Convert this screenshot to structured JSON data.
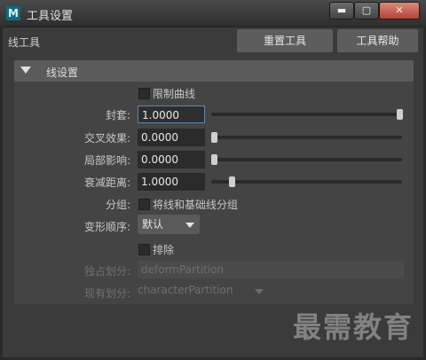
{
  "window": {
    "app_icon_letter": "M",
    "title": "工具设置",
    "minimize_glyph": "▬",
    "maximize_glyph": "▢",
    "close_glyph": "✕"
  },
  "toolbar": {
    "tool_name": "线工具",
    "reset_label": "重置工具",
    "help_label": "工具帮助"
  },
  "section": {
    "title": "线设置",
    "expanded": true
  },
  "settings": {
    "limit_curve_label": "限制曲线",
    "limit_curve_checked": false,
    "envelope": {
      "label": "封套:",
      "value": "1.0000",
      "slider_fraction": 1.0
    },
    "cross_effect": {
      "label": "交叉效果:",
      "value": "0.0000",
      "slider_fraction": 0.0
    },
    "local_influence": {
      "label": "局部影响:",
      "value": "0.0000",
      "slider_fraction": 0.0
    },
    "falloff_distance": {
      "label": "衰减距离:",
      "value": "1.0000",
      "slider_fraction": 0.1
    },
    "group_label": "分组:",
    "group_option_label": "将线和基础线分组",
    "group_checked": false,
    "deform_order_label": "变形顺序:",
    "deform_order_value": "默认",
    "exclude_label": "排除",
    "exclude_checked": false,
    "exclusive_partition_label": "独占划分:",
    "exclusive_partition_value": "deformPartition",
    "existing_partition_label": "现有划分:",
    "existing_partition_value": "characterPartition"
  },
  "watermark": "最需教育"
}
